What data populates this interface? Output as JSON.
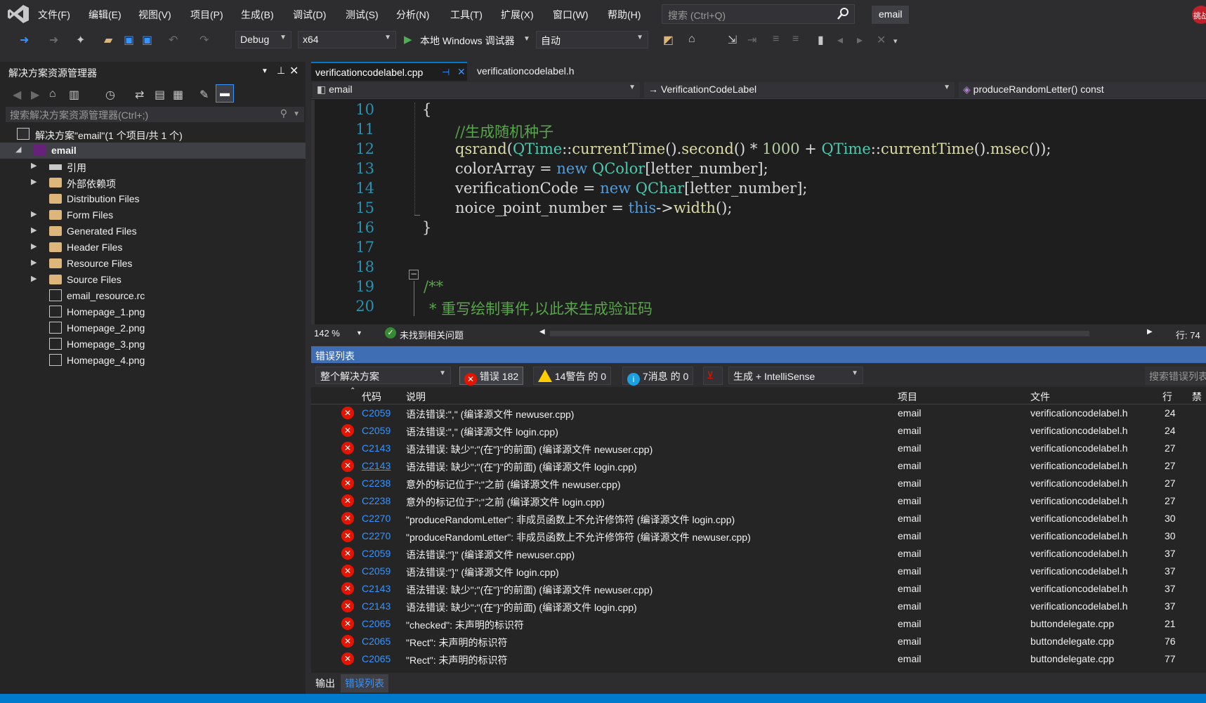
{
  "menubar": {
    "items": [
      "文件(F)",
      "编辑(E)",
      "视图(V)",
      "项目(P)",
      "生成(B)",
      "调试(D)",
      "测试(S)",
      "分析(N)",
      "工具(T)",
      "扩展(X)",
      "窗口(W)",
      "帮助(H)"
    ],
    "search_placeholder": "搜索 (Ctrl+Q)",
    "project_name": "email",
    "user_badge": "挑战"
  },
  "toolbar": {
    "config": "Debug",
    "platform": "x64",
    "debugger_label": "本地 Windows 调试器",
    "debugger_mode": "自动"
  },
  "solution_explorer": {
    "title": "解决方案资源管理器",
    "search_placeholder": "搜索解决方案资源管理器(Ctrl+;)",
    "items": [
      {
        "label": "解决方案\"email\"(1 个项目/共 1 个)",
        "icon": "solution-icon"
      },
      {
        "label": "email",
        "icon": "project-icon"
      },
      {
        "label": "引用",
        "icon": "references-icon"
      },
      {
        "label": "外部依赖项",
        "icon": "folder-icon"
      },
      {
        "label": "Distribution Files",
        "icon": "folder-icon"
      },
      {
        "label": "Form Files",
        "icon": "folder-icon"
      },
      {
        "label": "Generated Files",
        "icon": "folder-icon"
      },
      {
        "label": "Header Files",
        "icon": "folder-icon"
      },
      {
        "label": "Resource Files",
        "icon": "folder-icon"
      },
      {
        "label": "Source Files",
        "icon": "folder-icon"
      },
      {
        "label": "email_resource.rc",
        "icon": "resource-file-icon"
      },
      {
        "label": "Homepage_1.png",
        "icon": "image-file-icon"
      },
      {
        "label": "Homepage_2.png",
        "icon": "image-file-icon"
      },
      {
        "label": "Homepage_3.png",
        "icon": "image-file-icon"
      },
      {
        "label": "Homepage_4.png",
        "icon": "image-file-icon"
      }
    ]
  },
  "editor": {
    "tabs": [
      "verificationcodelabel.cpp",
      "verificationcodelabel.h"
    ],
    "nav_project": "email",
    "nav_class": "VerificationCodeLabel",
    "nav_member": "produceRandomLetter() const",
    "line_numbers": [
      "10",
      "11",
      "12",
      "13",
      "14",
      "15",
      "16",
      "17",
      "18",
      "19",
      "20"
    ],
    "zoom": "142 %",
    "issues": "未找到相关问题",
    "line_pos": "行: 74",
    "code": {
      "l10_brace": "{",
      "l11": "//生成随机种子",
      "l12_fn": "qsrand",
      "l12_a": "(",
      "l12_t1": "QTime",
      "l12_b": "::",
      "l12_f1": "currentTime",
      "l12_c": "().",
      "l12_f2": "second",
      "l12_d": "() * ",
      "l12_n": "1000",
      "l12_e": " + ",
      "l12_t2": "QTime",
      "l12_g": "::",
      "l12_f3": "currentTime",
      "l12_h": "().",
      "l12_f4": "msec",
      "l12_i": "());",
      "l13_v": "colorArray = ",
      "l13_k": "new",
      "l13_t": " QColor",
      "l13_r": "[letter_number];",
      "l14_v": "verificationCode = ",
      "l14_k": "new",
      "l14_t": " QChar",
      "l14_r": "[letter_number];",
      "l15_v": "noice_point_number = ",
      "l15_k": "this",
      "l15_a": "->",
      "l15_f": "width",
      "l15_r": "();",
      "l16_brace": "}",
      "l19": "/**",
      "l20": "* 重写绘制事件,以此来生成验证码"
    }
  },
  "error_list": {
    "title": "错误列表",
    "scope": "整个解决方案",
    "errors_label": "错误 182",
    "warnings_label": "14警告 的 0",
    "messages_label": "7消息 的 0",
    "build_filter": "生成 + IntelliSense",
    "search_placeholder": "搜索错误列表",
    "columns": [
      "代码",
      "说明",
      "项目",
      "文件",
      "行",
      "禁"
    ],
    "rows": [
      {
        "code": "C2059",
        "desc": "语法错误:\",\" (编译源文件 newuser.cpp)",
        "project": "email",
        "file": "verificationcodelabel.h",
        "line": "24"
      },
      {
        "code": "C2059",
        "desc": "语法错误:\",\" (编译源文件 login.cpp)",
        "project": "email",
        "file": "verificationcodelabel.h",
        "line": "24"
      },
      {
        "code": "C2143",
        "desc": "语法错误: 缺少\";\"(在\"}\"的前面) (编译源文件 newuser.cpp)",
        "project": "email",
        "file": "verificationcodelabel.h",
        "line": "27"
      },
      {
        "code": "C2143",
        "desc": "语法错误: 缺少\";\"(在\"}\"的前面) (编译源文件 login.cpp)",
        "project": "email",
        "file": "verificationcodelabel.h",
        "line": "27"
      },
      {
        "code": "C2238",
        "desc": "意外的标记位于\";\"之前 (编译源文件 newuser.cpp)",
        "project": "email",
        "file": "verificationcodelabel.h",
        "line": "27"
      },
      {
        "code": "C2238",
        "desc": "意外的标记位于\";\"之前 (编译源文件 login.cpp)",
        "project": "email",
        "file": "verificationcodelabel.h",
        "line": "27"
      },
      {
        "code": "C2270",
        "desc": "\"produceRandomLetter\": 非成员函数上不允许修饰符 (编译源文件 login.cpp)",
        "project": "email",
        "file": "verificationcodelabel.h",
        "line": "30"
      },
      {
        "code": "C2270",
        "desc": "\"produceRandomLetter\": 非成员函数上不允许修饰符 (编译源文件 newuser.cpp)",
        "project": "email",
        "file": "verificationcodelabel.h",
        "line": "30"
      },
      {
        "code": "C2059",
        "desc": "语法错误:\"}\" (编译源文件 newuser.cpp)",
        "project": "email",
        "file": "verificationcodelabel.h",
        "line": "37"
      },
      {
        "code": "C2059",
        "desc": "语法错误:\"}\" (编译源文件 login.cpp)",
        "project": "email",
        "file": "verificationcodelabel.h",
        "line": "37"
      },
      {
        "code": "C2143",
        "desc": "语法错误: 缺少\";\"(在\"}\"的前面) (编译源文件 newuser.cpp)",
        "project": "email",
        "file": "verificationcodelabel.h",
        "line": "37"
      },
      {
        "code": "C2143",
        "desc": "语法错误: 缺少\";\"(在\"}\"的前面) (编译源文件 login.cpp)",
        "project": "email",
        "file": "verificationcodelabel.h",
        "line": "37"
      },
      {
        "code": "C2065",
        "desc": "\"checked\": 未声明的标识符",
        "project": "email",
        "file": "buttondelegate.cpp",
        "line": "21"
      },
      {
        "code": "C2065",
        "desc": "\"Rect\": 未声明的标识符",
        "project": "email",
        "file": "buttondelegate.cpp",
        "line": "76"
      },
      {
        "code": "C2065",
        "desc": "\"Rect\": 未声明的标识符",
        "project": "email",
        "file": "buttondelegate.cpp",
        "line": "77"
      }
    ]
  },
  "bottom_tabs": [
    "输出",
    "错误列表"
  ]
}
